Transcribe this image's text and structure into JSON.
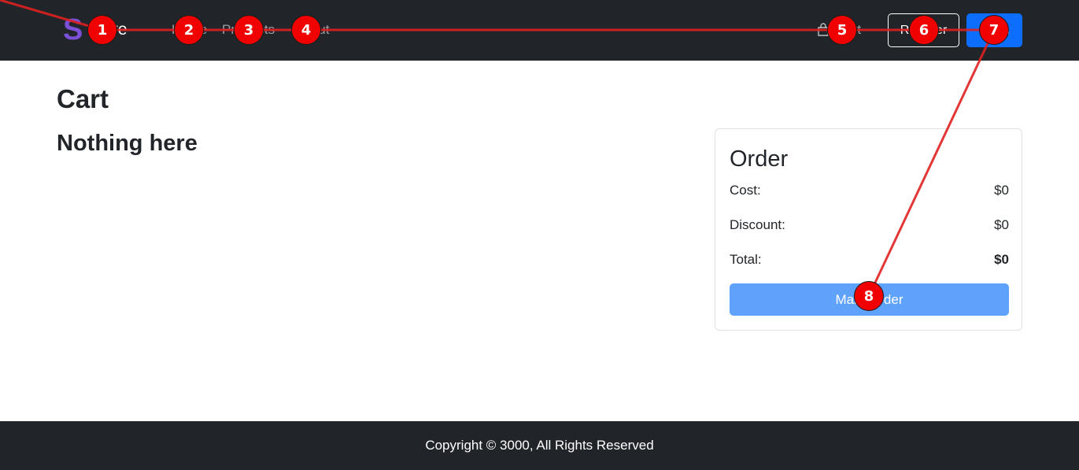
{
  "navbar": {
    "brand_logo": "S",
    "brand_text": "Store",
    "links": [
      "Home",
      "Products",
      "About"
    ],
    "cart_label": "Cart",
    "register_label": "Register",
    "login_label": "Login"
  },
  "main": {
    "title": "Cart",
    "empty_message": "Nothing here"
  },
  "order": {
    "title": "Order",
    "rows": [
      {
        "label": "Cost:",
        "value": "$0"
      },
      {
        "label": "Discount:",
        "value": "$0"
      },
      {
        "label": "Total:",
        "value": "$0"
      }
    ],
    "button_label": "Make order"
  },
  "footer": {
    "copyright": "Copyright © 3000, All Rights Reserved"
  },
  "annotations": [
    "1",
    "2",
    "3",
    "4",
    "5",
    "6",
    "7",
    "8"
  ],
  "colors": {
    "navbar_bg": "#212529",
    "brand_accent": "#7b4fd6",
    "primary": "#0d6efd",
    "primary_disabled": "#5fa2fc",
    "marker": "#f00000"
  }
}
